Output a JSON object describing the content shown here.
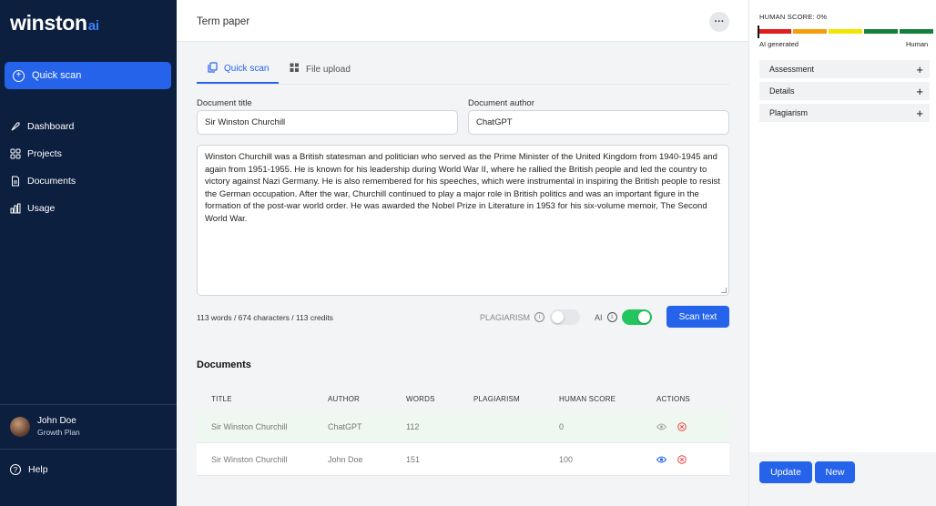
{
  "brand": {
    "name": "winston",
    "suffix": "ai"
  },
  "sidebar": {
    "quick_scan_label": "Quick scan",
    "items": [
      {
        "label": "Dashboard",
        "icon": "rocket-icon"
      },
      {
        "label": "Projects",
        "icon": "grid-icon"
      },
      {
        "label": "Documents",
        "icon": "document-icon"
      },
      {
        "label": "Usage",
        "icon": "bar-chart-icon"
      }
    ],
    "user": {
      "name": "John Doe",
      "plan": "Growth Plan"
    },
    "help_label": "Help"
  },
  "header": {
    "title": "Term paper",
    "more_label": "···"
  },
  "tabs": [
    {
      "label": "Quick scan",
      "icon": "copy-icon",
      "active": true
    },
    {
      "label": "File upload",
      "icon": "grid-icon",
      "active": false
    }
  ],
  "form": {
    "title_label": "Document title",
    "title_value": "Sir Winston Churchill",
    "author_label": "Document author",
    "author_value": "ChatGPT",
    "text": "Winston Churchill was a British statesman and politician who served as the Prime Minister of the United Kingdom from 1940-1945 and again from 1951-1955. He is known for his leadership during World War II, where he rallied the British people and led the country to victory against Nazi Germany. He is also remembered for his speeches, which were instrumental in inspiring the British people to resist the German occupation. After the war, Churchill continued to play a major role in British politics and was an important figure in the formation of the post-war world order. He was awarded the Nobel Prize in Literature in 1953 for his six-volume memoir, The Second World War.",
    "counts": "113 words / 674 characters / 113 credits",
    "plagiarism_label": "PLAGIARISM",
    "plagiarism_on": false,
    "ai_label": "AI",
    "ai_on": true,
    "scan_label": "Scan text"
  },
  "documents": {
    "heading": "Documents",
    "columns": [
      "TITLE",
      "AUTHOR",
      "WORDS",
      "PLAGIARISM",
      "HUMAN SCORE",
      "ACTIONS"
    ],
    "rows": [
      {
        "title": "Sir Winston Churchill",
        "author": "ChatGPT",
        "words": "112",
        "plagiarism": "",
        "human_score": "0"
      },
      {
        "title": "Sir Winston Churchill",
        "author": "John Doe",
        "words": "151",
        "plagiarism": "",
        "human_score": "100"
      }
    ]
  },
  "result": {
    "human_score_label": "HUMAN SCORE: 0%",
    "human_score": 0,
    "scale_left": "AI generated",
    "scale_right": "Human",
    "scale_colors": [
      "#e11d1d",
      "#f59e0b",
      "#f2e600",
      "#15803d",
      "#15803d"
    ],
    "sections": [
      "Assessment",
      "Details",
      "Plagiarism"
    ],
    "update_label": "Update",
    "new_label": "New"
  },
  "colors": {
    "sidebar": "#0c1f3f",
    "accent": "#2563eb",
    "toggle_on": "#22c55e",
    "toggle_off": "#d1d5db"
  }
}
